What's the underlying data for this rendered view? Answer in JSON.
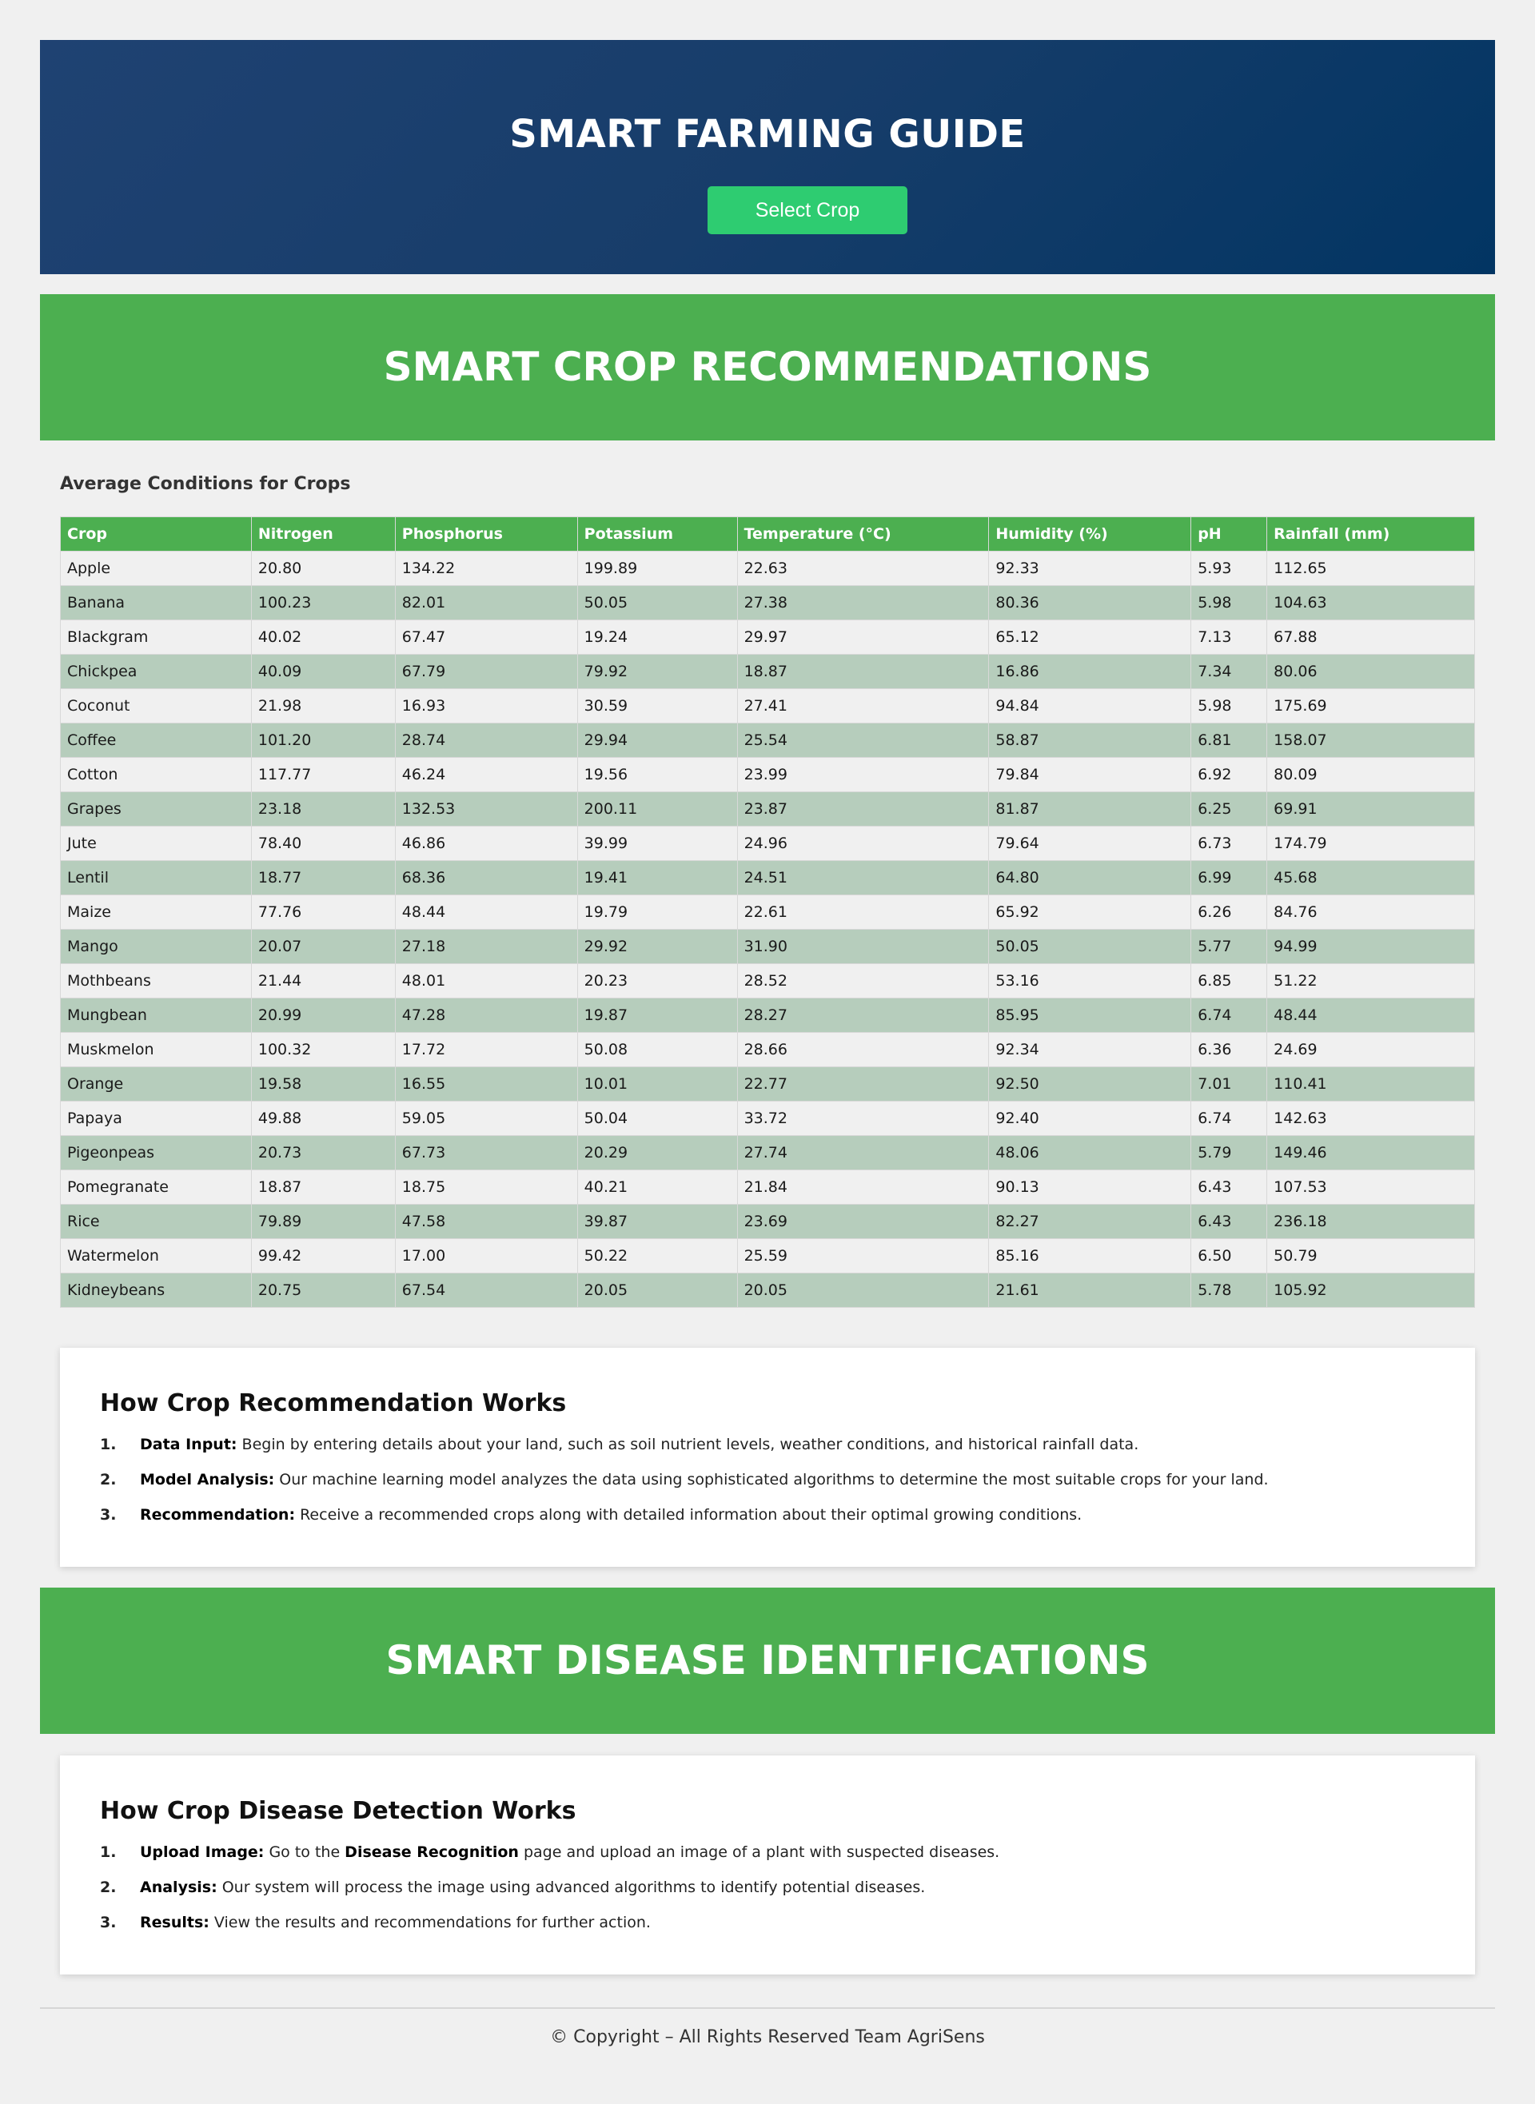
{
  "hero": {
    "title": "SMART FARMING GUIDE",
    "button_label": "Select Crop",
    "gradient_colors": [
      "#1f4272",
      "#023563"
    ],
    "button_color": "#2ecc71"
  },
  "recommend_banner": {
    "title": "SMART CROP RECOMMENDATIONS",
    "color": "#4caf50"
  },
  "table": {
    "title": "Average Conditions for Crops",
    "headers": [
      "Crop",
      "Nitrogen",
      "Phosphorus",
      "Potassium",
      "Temperature (°C)",
      "Humidity (%)",
      "pH",
      "Rainfall (mm)"
    ],
    "rows": [
      [
        "Apple",
        "20.80",
        "134.22",
        "199.89",
        "22.63",
        "92.33",
        "5.93",
        "112.65"
      ],
      [
        "Banana",
        "100.23",
        "82.01",
        "50.05",
        "27.38",
        "80.36",
        "5.98",
        "104.63"
      ],
      [
        "Blackgram",
        "40.02",
        "67.47",
        "19.24",
        "29.97",
        "65.12",
        "7.13",
        "67.88"
      ],
      [
        "Chickpea",
        "40.09",
        "67.79",
        "79.92",
        "18.87",
        "16.86",
        "7.34",
        "80.06"
      ],
      [
        "Coconut",
        "21.98",
        "16.93",
        "30.59",
        "27.41",
        "94.84",
        "5.98",
        "175.69"
      ],
      [
        "Coffee",
        "101.20",
        "28.74",
        "29.94",
        "25.54",
        "58.87",
        "6.81",
        "158.07"
      ],
      [
        "Cotton",
        "117.77",
        "46.24",
        "19.56",
        "23.99",
        "79.84",
        "6.92",
        "80.09"
      ],
      [
        "Grapes",
        "23.18",
        "132.53",
        "200.11",
        "23.87",
        "81.87",
        "6.25",
        "69.91"
      ],
      [
        "Jute",
        "78.40",
        "46.86",
        "39.99",
        "24.96",
        "79.64",
        "6.73",
        "174.79"
      ],
      [
        "Lentil",
        "18.77",
        "68.36",
        "19.41",
        "24.51",
        "64.80",
        "6.99",
        "45.68"
      ],
      [
        "Maize",
        "77.76",
        "48.44",
        "19.79",
        "22.61",
        "65.92",
        "6.26",
        "84.76"
      ],
      [
        "Mango",
        "20.07",
        "27.18",
        "29.92",
        "31.90",
        "50.05",
        "5.77",
        "94.99"
      ],
      [
        "Mothbeans",
        "21.44",
        "48.01",
        "20.23",
        "28.52",
        "53.16",
        "6.85",
        "51.22"
      ],
      [
        "Mungbean",
        "20.99",
        "47.28",
        "19.87",
        "28.27",
        "85.95",
        "6.74",
        "48.44"
      ],
      [
        "Muskmelon",
        "100.32",
        "17.72",
        "50.08",
        "28.66",
        "92.34",
        "6.36",
        "24.69"
      ],
      [
        "Orange",
        "19.58",
        "16.55",
        "10.01",
        "22.77",
        "92.50",
        "7.01",
        "110.41"
      ],
      [
        "Papaya",
        "49.88",
        "59.05",
        "50.04",
        "33.72",
        "92.40",
        "6.74",
        "142.63"
      ],
      [
        "Pigeonpeas",
        "20.73",
        "67.73",
        "20.29",
        "27.74",
        "48.06",
        "5.79",
        "149.46"
      ],
      [
        "Pomegranate",
        "18.87",
        "18.75",
        "40.21",
        "21.84",
        "90.13",
        "6.43",
        "107.53"
      ],
      [
        "Rice",
        "79.89",
        "47.58",
        "39.87",
        "23.69",
        "82.27",
        "6.43",
        "236.18"
      ],
      [
        "Watermelon",
        "99.42",
        "17.00",
        "50.22",
        "25.59",
        "85.16",
        "6.50",
        "50.79"
      ],
      [
        "Kidneybeans",
        "20.75",
        "67.54",
        "20.05",
        "20.05",
        "21.61",
        "5.78",
        "105.92"
      ]
    ]
  },
  "recommend_card": {
    "title": "How Crop Recommendation Works",
    "steps": [
      {
        "num": "1.",
        "lead": "Data Input:",
        "text": " Begin by entering details about your land, such as soil nutrient levels, weather conditions, and historical rainfall data."
      },
      {
        "num": "2.",
        "lead": "Model Analysis:",
        "text": " Our machine learning model analyzes the data using sophisticated algorithms to determine the most suitable crops for your land."
      },
      {
        "num": "3.",
        "lead": "Recommendation:",
        "text": " Receive a recommended crops along with detailed information about their optimal growing conditions."
      }
    ]
  },
  "disease_banner": {
    "title": "SMART DISEASE IDENTIFICATIONS"
  },
  "disease_card": {
    "title": "How Crop Disease Detection Works",
    "steps": [
      {
        "num": "1.",
        "lead": "Upload Image:",
        "text_before": " Go to the ",
        "link": "Disease Recognition",
        "text_after": " page and upload an image of a plant with suspected diseases."
      },
      {
        "num": "2.",
        "lead": "Analysis:",
        "text": " Our system will process the image using advanced algorithms to identify potential diseases."
      },
      {
        "num": "3.",
        "lead": "Results:",
        "text": " View the results and recommendations for further action."
      }
    ]
  },
  "footer": {
    "text": "© Copyright – All Rights Reserved Team AgriSens"
  }
}
